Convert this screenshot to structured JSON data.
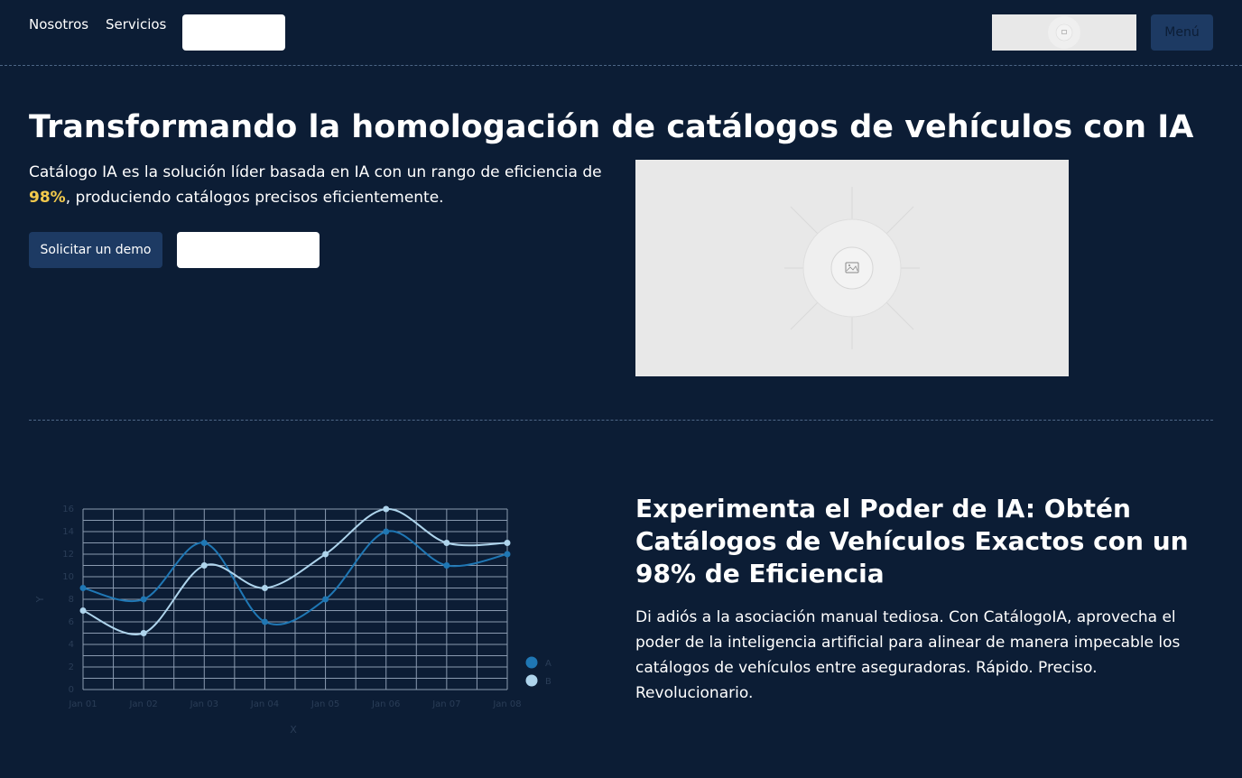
{
  "nav": {
    "links": [
      "Nosotros",
      "Servicios"
    ],
    "menu_label": "Menú",
    "logo_icon": "image-placeholder-icon"
  },
  "hero": {
    "title": "Transformando la homologación de catálogos de vehículos con IA",
    "text_before": "Catálogo IA es la solución líder basada en IA con un rango de eficiencia de ",
    "highlight": "98%",
    "text_after": ", produciendo catálogos precisos eficientemente.",
    "demo_button": "Solicitar un demo",
    "image_icon": "image-placeholder-icon"
  },
  "feature": {
    "title": "Experimenta el Poder de IA: Obtén Catálogos de Vehículos Exactos con un 98% de Eficiencia",
    "text": "Di adiós a la asociación manual tediosa. Con CatálogoIA, aprovecha el poder de la inteligencia artificial para alinear de manera impecable los catálogos de vehículos entre aseguradoras. Rápido. Preciso. Revolucionario."
  },
  "colors": {
    "background": "#0c1d35",
    "primary_button": "#1d3a63",
    "highlight": "#f2c94c",
    "series_a": "#1f77b4",
    "series_b": "#aed4ec"
  },
  "chart_data": {
    "type": "line",
    "categories": [
      "Jan 01",
      "Jan 02",
      "Jan 03",
      "Jan 04",
      "Jan 05",
      "Jan 06",
      "Jan 07",
      "Jan 08"
    ],
    "series": [
      {
        "name": "A",
        "values": [
          9,
          8,
          13,
          6,
          8,
          14,
          11,
          12
        ],
        "color": "#1f77b4"
      },
      {
        "name": "B",
        "values": [
          7,
          5,
          11,
          9,
          12,
          16,
          13,
          13
        ],
        "color": "#aed4ec"
      }
    ],
    "xlabel": "X",
    "ylabel": "Y",
    "ylim": [
      0,
      16
    ],
    "yticks": [
      0,
      2,
      4,
      6,
      8,
      10,
      12,
      14,
      16
    ],
    "grid": true,
    "legend": "right"
  }
}
